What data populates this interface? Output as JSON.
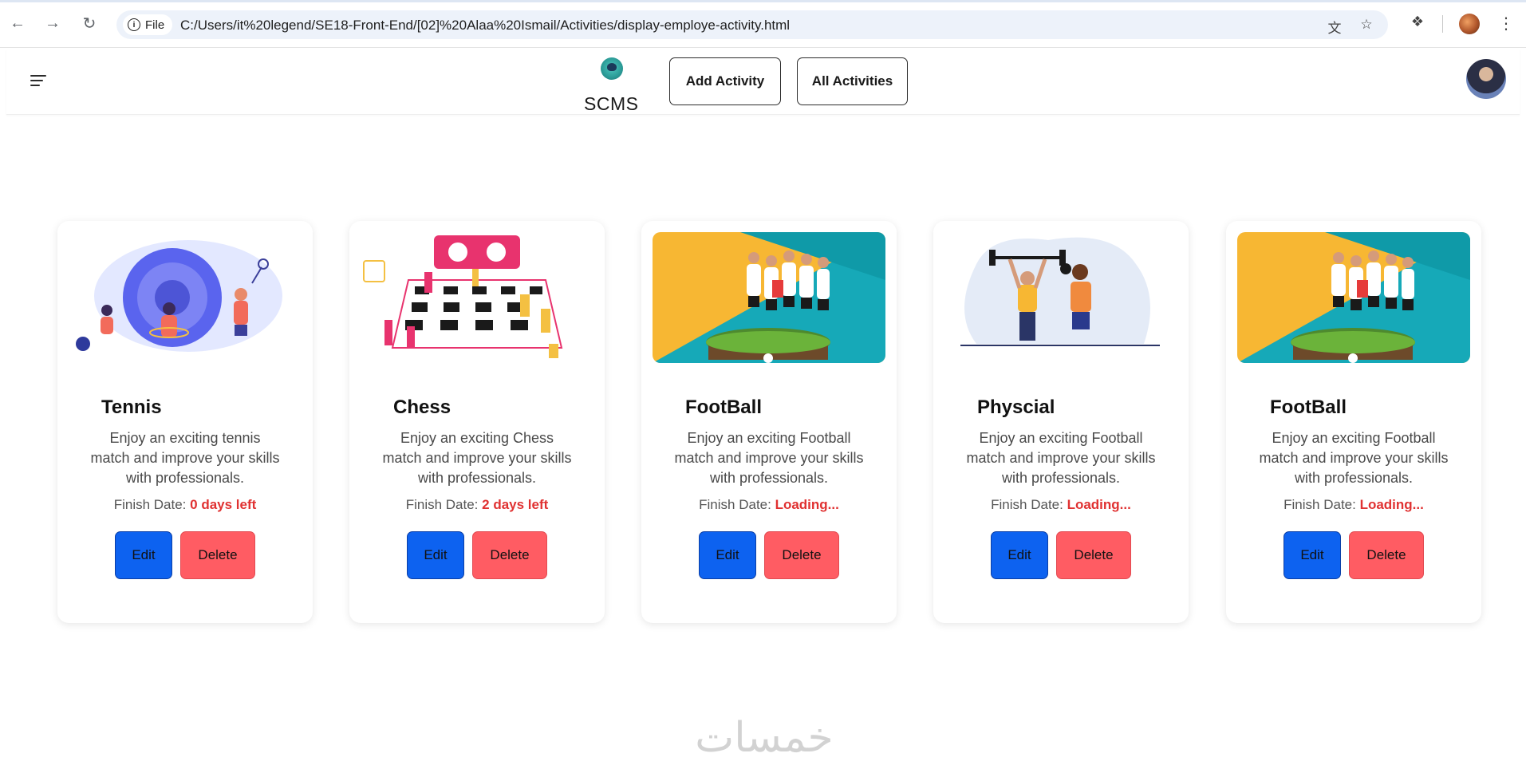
{
  "browser": {
    "file_label": "File",
    "url": "C:/Users/it%20legend/SE18-Front-End/[02]%20Alaa%20Ismail/Activities/display-employe-activity.html"
  },
  "app": {
    "brand": "SCMS",
    "nav": {
      "add_activity": "Add Activity",
      "all_activities": "All Activities"
    }
  },
  "cards": [
    {
      "title": "Tennis",
      "description": "Enjoy an exciting tennis match and improve your skills with professionals.",
      "finish_label": "Finish Date:",
      "finish_value": "0 days left",
      "edit": "Edit",
      "delete": "Delete",
      "image": "tennis-illustration"
    },
    {
      "title": "Chess",
      "description": "Enjoy an exciting Chess match and improve your skills with professionals.",
      "finish_label": "Finish Date:",
      "finish_value": "2 days left",
      "edit": "Edit",
      "delete": "Delete",
      "image": "chess-illustration"
    },
    {
      "title": "FootBall",
      "description": "Enjoy an exciting Football match and improve your skills with professionals.",
      "finish_label": "Finish Date:",
      "finish_value": "Loading...",
      "edit": "Edit",
      "delete": "Delete",
      "image": "football-team-photo"
    },
    {
      "title": "Physcial",
      "description": "Enjoy an exciting Football match and improve your skills with professionals.",
      "finish_label": "Finish Date:",
      "finish_value": "Loading...",
      "edit": "Edit",
      "delete": "Delete",
      "image": "fitness-illustration"
    },
    {
      "title": "FootBall",
      "description": "Enjoy an exciting Football match and improve your skills with professionals.",
      "finish_label": "Finish Date:",
      "finish_value": "Loading...",
      "edit": "Edit",
      "delete": "Delete",
      "image": "football-team-photo"
    }
  ],
  "watermark": "خمسات",
  "colors": {
    "edit_button": "#0d62f0",
    "delete_button": "#ff5c63",
    "finish_value": "#e03131"
  }
}
